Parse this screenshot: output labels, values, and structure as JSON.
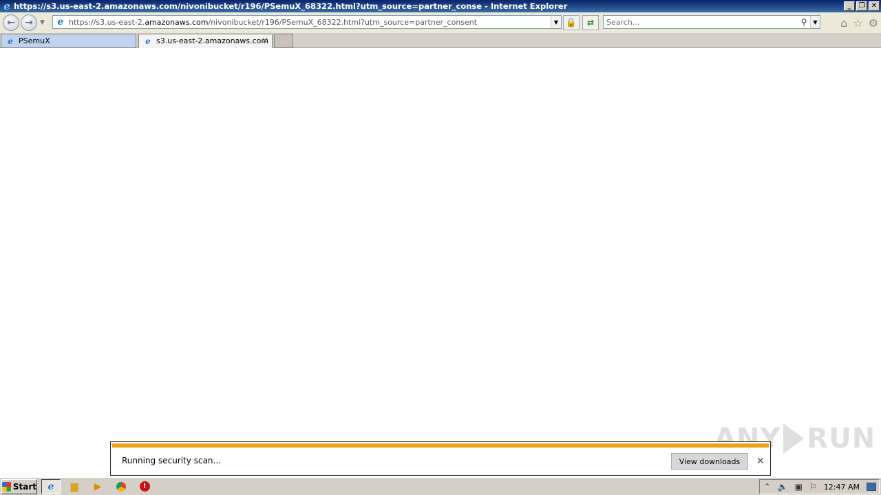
{
  "window": {
    "title": "https://s3.us-east-2.amazonaws.com/nivonibucket/r196/PSemuX_68322.html?utm_source=partner_conse - Internet Explorer",
    "buttons": {
      "minimize": "_",
      "restore": "❐",
      "close": "✕"
    }
  },
  "addressbar": {
    "url_prefix": "https://s3.us-east-2.",
    "url_host": "amazonaws.com",
    "url_suffix": "/nivonibucket/r196/PSemuX_68322.html?utm_source=partner_consent"
  },
  "search": {
    "placeholder": "Search..."
  },
  "tabs": [
    {
      "label": "PSemuX"
    },
    {
      "label": "s3.us-east-2.amazonaws.com"
    }
  ],
  "download_bar": {
    "message": "Running security scan...",
    "view_downloads_label": "View downloads",
    "progress": 1.0,
    "accent_color": "#e8a317"
  },
  "watermark": {
    "left": "ANY",
    "right": "RUN"
  },
  "taskbar": {
    "start_label": "Start",
    "clock": "12:47 AM"
  }
}
